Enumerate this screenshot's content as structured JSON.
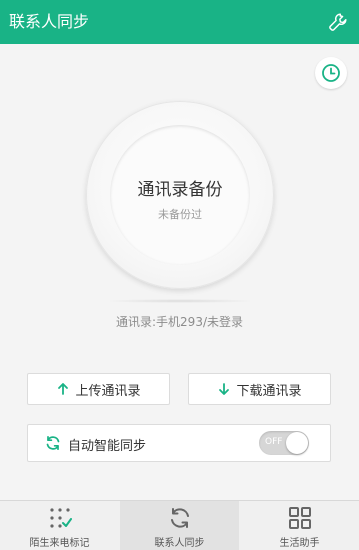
{
  "header": {
    "title": "联系人同步",
    "settings_icon": "wrench-icon"
  },
  "main": {
    "history_icon": "clock-icon",
    "circle_title": "通讯录备份",
    "circle_subtitle": "未备份过",
    "status": "通讯录:手机293/未登录"
  },
  "actions": {
    "upload_label": "上传通讯录",
    "download_label": "下载通讯录"
  },
  "auto_sync": {
    "label": "自动智能同步",
    "toggle_text": "OFF",
    "enabled": false
  },
  "bottom_nav": {
    "items": [
      {
        "label": "陌生来电标记",
        "icon": "dial-check-icon"
      },
      {
        "label": "联系人同步",
        "icon": "sync-icon",
        "active": true
      },
      {
        "label": "生活助手",
        "icon": "grid-icon"
      }
    ]
  },
  "colors": {
    "accent": "#19b386",
    "background": "#f4f4f4"
  }
}
